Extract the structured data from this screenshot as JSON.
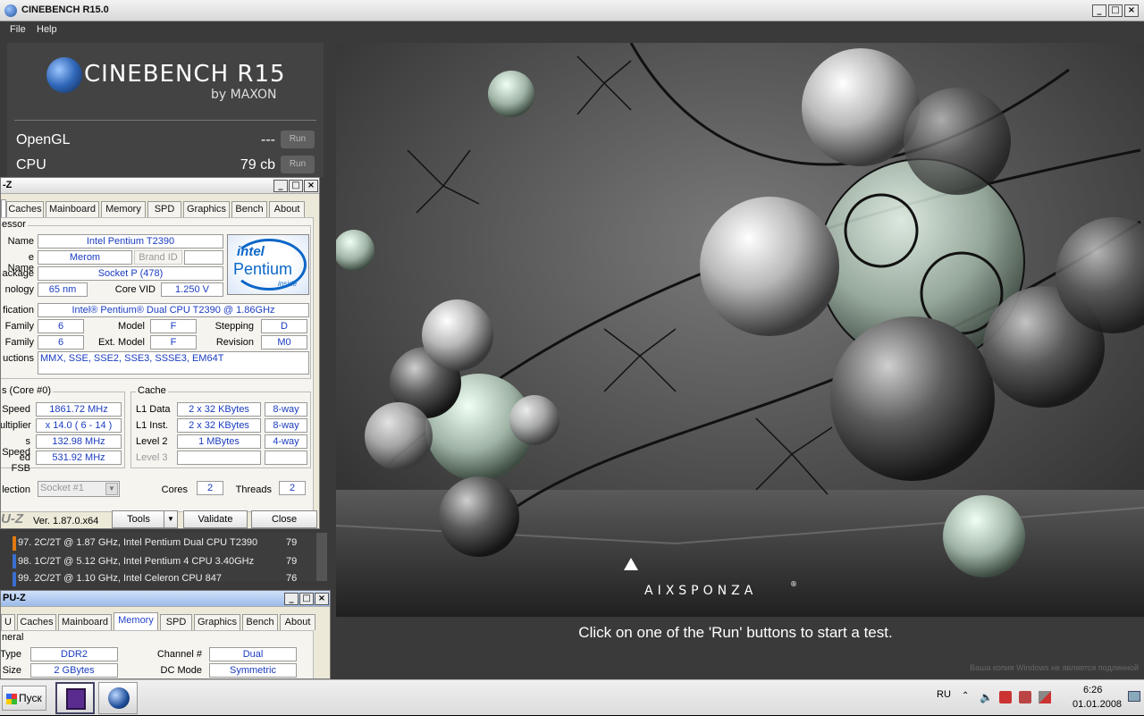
{
  "window": {
    "title": "CINEBENCH R15.0",
    "min": "_",
    "max": "□",
    "close": "×"
  },
  "menu": [
    "File",
    "Help"
  ],
  "brand": {
    "name": "CINEBENCH R15",
    "by": "by MAXON"
  },
  "benchmarks": [
    {
      "label": "OpenGL",
      "value": "---",
      "run": "Run"
    },
    {
      "label": "CPU",
      "value": "79 cb",
      "run": "Run"
    }
  ],
  "ranking": [
    {
      "text": "97. 2C/2T @ 1.87 GHz, Intel Pentium Dual CPU T2390",
      "score": "79",
      "color": "#e07a10"
    },
    {
      "text": "98. 1C/2T @ 5.12 GHz,  Intel Pentium 4 CPU 3.40GHz",
      "score": "79",
      "color": "#3a6fd0"
    },
    {
      "text": "99. 2C/2T @ 1.10 GHz,  Intel Celeron CPU 847",
      "score": "76",
      "color": "#3a6fd0"
    }
  ],
  "render": {
    "watermark": "AIXSPONZA",
    "trademark": "®"
  },
  "caption": "Click on one of the 'Run' buttons to start a test.",
  "windows_notice": "Ваша копия Windows не является подлинной",
  "cpuz1": {
    "title": "-Z",
    "tabs": [
      "",
      "Caches",
      "Mainboard",
      "Memory",
      "SPD",
      "Graphics",
      "Bench",
      "About"
    ],
    "section": "essor",
    "labels": {
      "name": "Name",
      "codename": "e Name",
      "brandid": "Brand ID",
      "package": "ackage",
      "tech": "nology",
      "corevid": "Core VID",
      "spec": "fication",
      "family": "Family",
      "model": "Model",
      "stepping": "Stepping",
      "extfamily": "Family",
      "extmodel": "Ext. Model",
      "revision": "Revision",
      "instr": "uctions"
    },
    "values": {
      "name": "Intel Pentium T2390",
      "codename": "Merom",
      "package": "Socket P (478)",
      "tech": "65 nm",
      "corevid": "1.250 V",
      "spec": "Intel® Pentium® Dual  CPU  T2390  @ 1.86GHz",
      "family": "6",
      "model": "F",
      "stepping": "D",
      "extfamily": "6",
      "extmodel": "F",
      "revision": "M0",
      "instr": "MMX, SSE, SSE2, SSE3, SSSE3, EM64T"
    },
    "logo": {
      "brand": "intel",
      "product": "Pentium",
      "tag": "inside"
    },
    "clocks": {
      "title": "s (Core #0)",
      "labels": [
        "Speed",
        "ultiplier",
        "s Speed",
        "ed FSB"
      ],
      "values": [
        "1861.72 MHz",
        "x 14.0 ( 6 - 14 )",
        "132.98 MHz",
        "531.92 MHz"
      ]
    },
    "cache": {
      "title": "Cache",
      "labels": [
        "L1 Data",
        "L1 Inst.",
        "Level 2",
        "Level 3"
      ],
      "sizes": [
        "2 x 32 KBytes",
        "2 x 32 KBytes",
        "1 MBytes",
        ""
      ],
      "ways": [
        "8-way",
        "8-way",
        "4-way",
        ""
      ]
    },
    "selection": {
      "label": "lection",
      "value": "Socket #1",
      "cores_label": "Cores",
      "cores": "2",
      "threads_label": "Threads",
      "threads": "2"
    },
    "footer": {
      "brand": "U-Z",
      "version": "Ver. 1.87.0.x64",
      "tools": "Tools",
      "validate": "Validate",
      "close": "Close"
    }
  },
  "cpuz2": {
    "title": "PU-Z",
    "tabs": [
      "U",
      "Caches",
      "Mainboard",
      "Memory",
      "SPD",
      "Graphics",
      "Bench",
      "About"
    ],
    "section": "neral",
    "labels": {
      "type": "Type",
      "size": "Size",
      "channel": "Channel #",
      "dcmode": "DC Mode"
    },
    "values": {
      "type": "DDR2",
      "size": "2 GBytes",
      "channel": "Dual",
      "dcmode": "Symmetric"
    }
  },
  "taskbar": {
    "start": "Пуск",
    "lang": "RU",
    "time": "6:26",
    "date": "01.01.2008"
  }
}
